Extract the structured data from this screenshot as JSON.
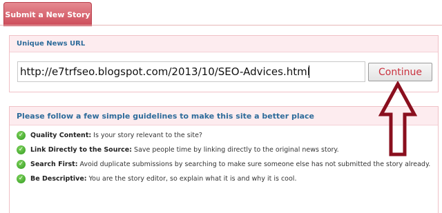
{
  "tab": {
    "label": "Submit a New Story"
  },
  "url_section": {
    "title": "Unique News URL",
    "input_value": "http://e7trfseo.blogspot.com/2013/10/SEO-Advices.html",
    "continue_label": "Continue"
  },
  "guidelines": {
    "title": "Please follow a few simple guidelines to make this site a better place",
    "items": [
      {
        "label": "Quality Content:",
        "text": " Is your story relevant to the site?"
      },
      {
        "label": "Link Directly to the Source:",
        "text": " Save people time by linking directly to the original news story."
      },
      {
        "label": "Search First:",
        "text": " Avoid duplicate submissions by searching to make sure someone else has not submitted the story already."
      },
      {
        "label": "Be Descriptive:",
        "text": " You are the story editor, so explain what it is and why it is cool."
      }
    ]
  },
  "colors": {
    "tab": "#cc4a58",
    "panel_header": "#fdecef",
    "link_blue": "#2d6b9a",
    "continue_text": "#c9323f",
    "arrow": "#8a0f1e",
    "check": "#2f9a1f"
  },
  "icons": {
    "guideline_bullet": "check-icon",
    "annotation": "up-arrow-annotation"
  }
}
